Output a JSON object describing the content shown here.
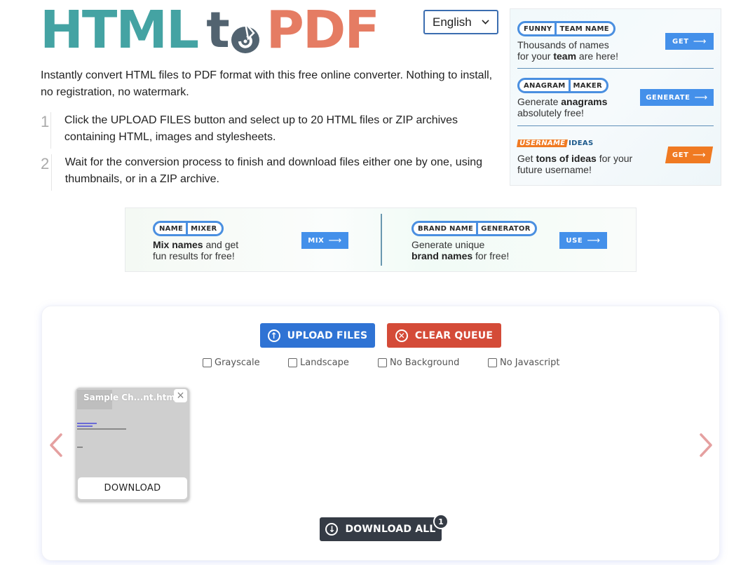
{
  "logo": {
    "part1": "HTML",
    "part2": "t",
    "part3": "PDF",
    "colors": {
      "html": "#44a3a3",
      "to": "#526370",
      "pdf": "#e57c63"
    }
  },
  "language": {
    "selected": "English"
  },
  "intro": "Instantly convert HTML files to PDF format with this free online converter. Nothing to install, no registration, no watermark.",
  "steps": [
    {
      "num": "1",
      "text": "Click the UPLOAD FILES button and select up to 20 HTML files or ZIP archives containing HTML, images and stylesheets."
    },
    {
      "num": "2",
      "text": "Wait for the conversion process to finish and download files either one by one, using thumbnails, or in a ZIP archive."
    }
  ],
  "ad_right": [
    {
      "tag_left": "FUNNY",
      "tag_right": "TEAM NAME",
      "desc_1": "Thousands of names",
      "desc_2_pre": "for your ",
      "desc_2_bold": "team",
      "desc_2_post": " are here!",
      "button": "GET"
    },
    {
      "tag_left": "ANAGRAM",
      "tag_right": "MAKER",
      "desc_1_pre": "Generate ",
      "desc_1_bold": "anagrams",
      "desc_2": "absolutely free!",
      "button": "GENERATE"
    },
    {
      "tag_left": "USERNAME",
      "tag_right": "IDEAS",
      "desc_1_pre": "Get ",
      "desc_1_bold": "tons of ideas",
      "desc_1_post": " for your",
      "desc_2": "future username!",
      "button": "GET"
    }
  ],
  "ad_mid": [
    {
      "tag_left": "NAME",
      "tag_right": "MIXER",
      "desc_1_bold": "Mix names",
      "desc_1_post": " and get",
      "desc_2": "fun results for free!",
      "button": "MIX"
    },
    {
      "tag_left": "BRAND NAME",
      "tag_right": "GENERATOR",
      "desc_1": "Generate unique",
      "desc_2_bold": "brand names",
      "desc_2_post": " for free!",
      "button": "USE"
    }
  ],
  "toolbar": {
    "upload": "UPLOAD FILES",
    "clear": "CLEAR QUEUE"
  },
  "options": [
    {
      "label": "Grayscale",
      "checked": false
    },
    {
      "label": "Landscape",
      "checked": false
    },
    {
      "label": "No Background",
      "checked": false
    },
    {
      "label": "No Javascript",
      "checked": false
    }
  ],
  "files": [
    {
      "name": "Sample Ch...nt.html",
      "download_label": "DOWNLOAD"
    }
  ],
  "download_all": {
    "label": "DOWNLOAD ALL",
    "count": "1"
  },
  "colors": {
    "upload": "#2f73d4",
    "clear": "#d44b38",
    "download_all": "#353b45",
    "ad_blue": "#4490ea",
    "ad_orange": "#f07a22",
    "nav_arrow": "#e5a0a0"
  }
}
